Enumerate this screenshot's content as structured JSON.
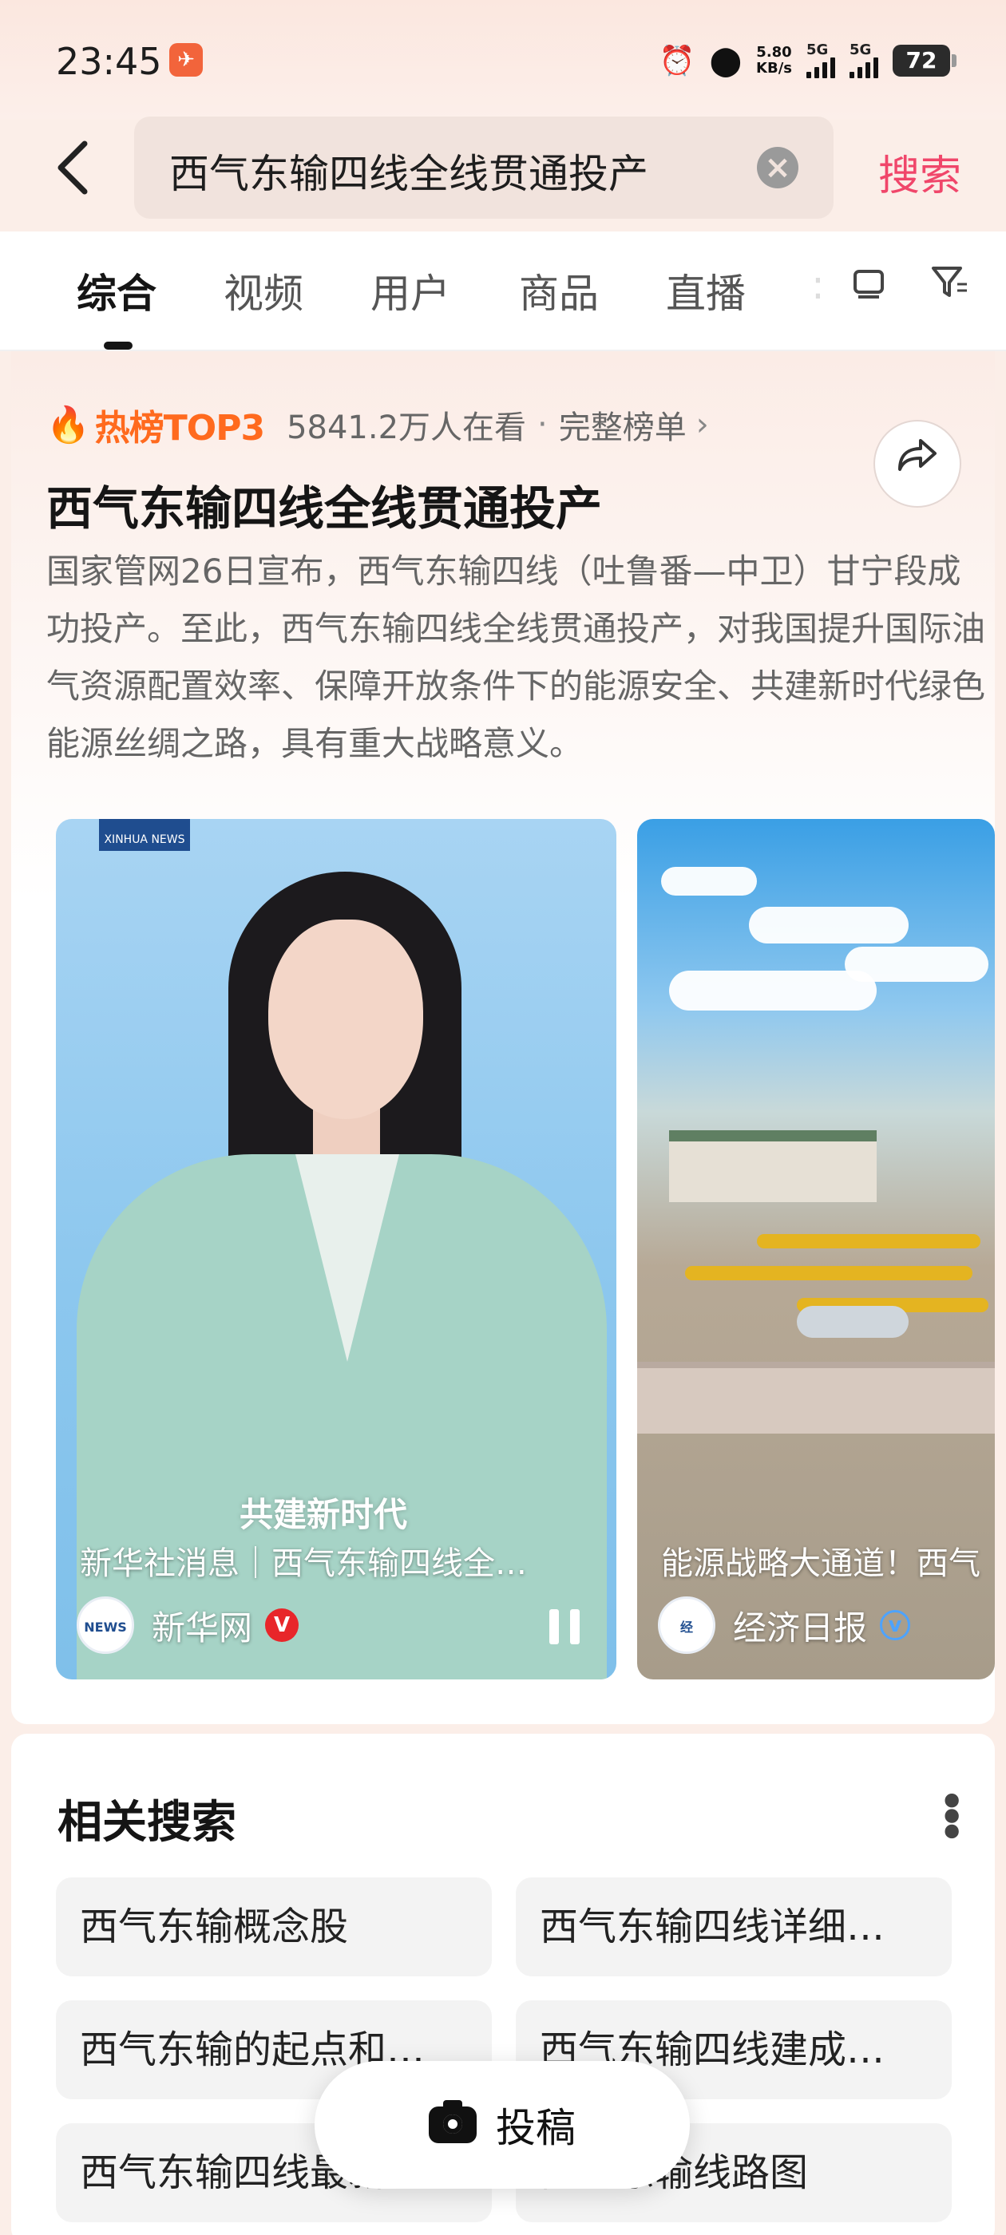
{
  "status_bar": {
    "time": "23:45",
    "net_speed_value": "5.80",
    "net_speed_unit": "KB/s",
    "signal1_label": "5G",
    "signal2_label": "5G",
    "battery": "72"
  },
  "search": {
    "query": "西气东输四线全线贯通投产",
    "submit_label": "搜索"
  },
  "tabs": [
    {
      "label": "综合",
      "active": true
    },
    {
      "label": "视频",
      "active": false
    },
    {
      "label": "用户",
      "active": false
    },
    {
      "label": "商品",
      "active": false
    },
    {
      "label": "直播",
      "active": false
    }
  ],
  "hot": {
    "badge": "热榜TOP3",
    "viewers": "5841.2万人在看",
    "separator": "·",
    "full_list": "完整榜单",
    "title": "西气东输四线全线贯通投产",
    "description": "国家管网26日宣布，西气东输四线（吐鲁番—中卫）甘宁段成功投产。至此，西气东输四线全线贯通投产，对我国提升国际油气资源配置效率、保障开放条件下的能源安全、共建新时代绿色能源丝绸之路，具有重大战略意义。"
  },
  "videos": [
    {
      "caption": "新华社消息｜西气东输四线全…",
      "subtitle_overlay": "共建新时代",
      "author": "新华网",
      "verified_color": "#e8262a",
      "logo_text": "XINHUA NEWS"
    },
    {
      "caption": "能源战略大通道！西气",
      "author": "经济日报",
      "verified_color": "#4da3ff"
    }
  ],
  "related": {
    "title": "相关搜索",
    "items": [
      "西气东输概念股",
      "西气东输四线详细…",
      "西气东输的起点和…",
      "西气东输四线建成…",
      "西气东输四线最新",
      "西气东输线路图"
    ]
  },
  "fab": {
    "label": "投稿"
  },
  "colors": {
    "accent": "#f0466a",
    "hot": "#ff6a1e"
  }
}
